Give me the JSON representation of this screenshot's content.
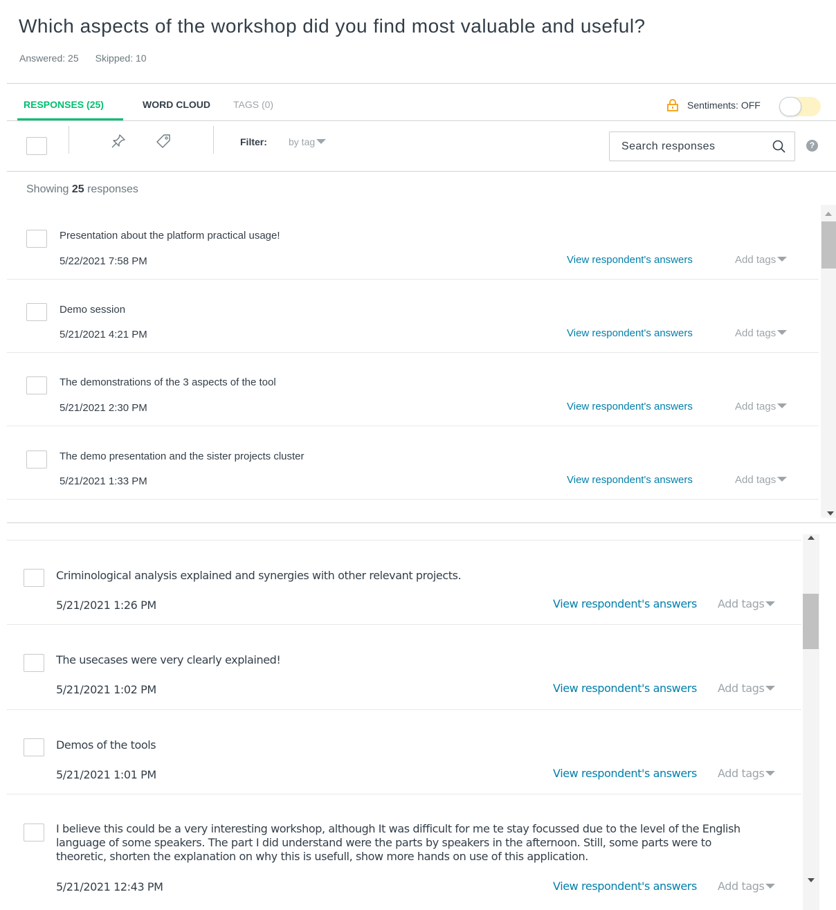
{
  "question": {
    "title": "Which aspects of the workshop did you find most valuable and useful?",
    "answered": "Answered: 25",
    "skipped": "Skipped: 10"
  },
  "tabs": [
    {
      "label": "RESPONSES (25)",
      "active": true
    },
    {
      "label": "WORD CLOUD",
      "active": false
    },
    {
      "label": "TAGS (0)",
      "active": false
    }
  ],
  "sentiments": {
    "label": "Sentiments: OFF",
    "state": "off",
    "lock_icon": "lock-icon",
    "toggle_color": "#fdf3c5"
  },
  "toolbar": {
    "pin_icon": "pin-icon",
    "tag_icon": "tag-icon",
    "filter_label": "Filter:",
    "filter_value": "by tag",
    "search_placeholder": "Search responses",
    "help_label": "?"
  },
  "showing": {
    "prefix": "Showing",
    "count": "25",
    "suffix": "responses"
  },
  "responses": [
    {
      "text": "Presentation about the platform practical usage!",
      "date": "5/22/2021 7:58 PM",
      "link": "View respondent's answers",
      "tags": "Add tags"
    },
    {
      "text": "Demo session",
      "date": "5/21/2021 4:21 PM",
      "link": "View respondent's answers",
      "tags": "Add tags"
    },
    {
      "text": "The demonstrations of the 3 aspects of the tool",
      "date": "5/21/2021 2:30 PM",
      "link": "View respondent's answers",
      "tags": "Add tags"
    },
    {
      "text": "The demo presentation and the sister projects cluster",
      "date": "5/21/2021 1:33 PM",
      "link": "View respondent's answers",
      "tags": "Add tags"
    },
    {
      "text": "Criminological analysis explained and synergies with other relevant projects.",
      "date": "5/21/2021 1:26 PM",
      "link": "View respondent's answers",
      "tags": "Add tags"
    },
    {
      "text": "The usecases were very clearly explained!",
      "date": "5/21/2021 1:02 PM",
      "link": "View respondent's answers",
      "tags": "Add tags"
    },
    {
      "text": "Demos of the tools",
      "date": "5/21/2021 1:01 PM",
      "link": "View respondent's answers",
      "tags": "Add tags"
    },
    {
      "text": "I believe this could be a very interesting workshop, although It was difficult for me te stay focussed due to the level of the English language of some speakers. The part I did understand were the parts by speakers in the afternoon. Still, some parts were to theoretic, shorten the explanation on why this is usefull, show more hands on use of this application.",
      "date": "5/21/2021 12:43 PM",
      "link": "View respondent's answers",
      "tags": "Add tags"
    }
  ],
  "colors": {
    "accent_green": "#00bf6f",
    "link_blue": "#007faa",
    "muted": "#9da5aa",
    "text": "#333e48"
  }
}
